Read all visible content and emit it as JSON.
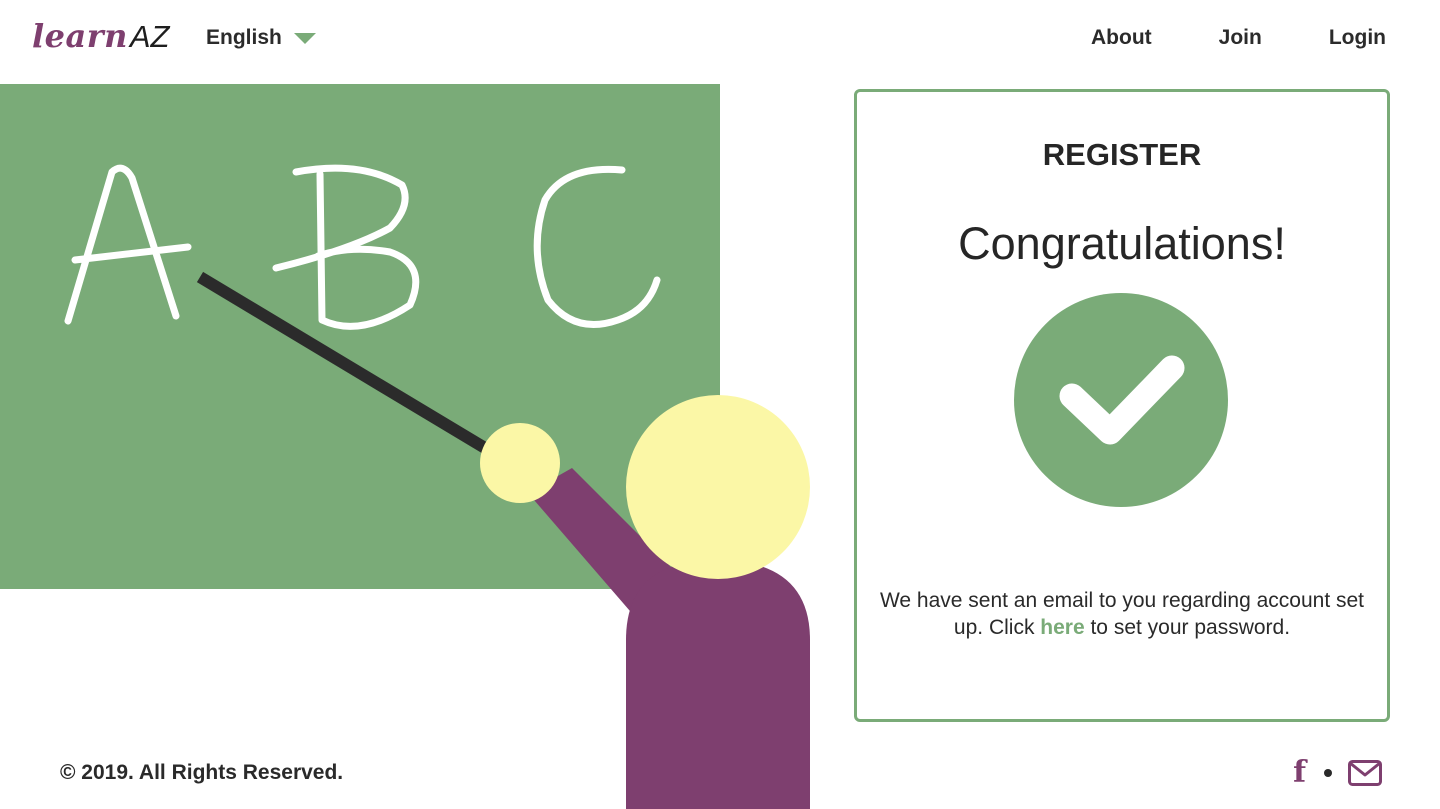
{
  "header": {
    "logo_learn": "learn",
    "logo_az": "AZ",
    "language": "English",
    "nav": {
      "about": "About",
      "join": "Join",
      "login": "Login"
    }
  },
  "illustration": {
    "letters": [
      "A",
      "B",
      "C"
    ]
  },
  "register": {
    "title": "REGISTER",
    "heading": "Congratulations!",
    "message_before": "We have sent an email to you regarding account set up. Click ",
    "link": "here",
    "message_after": " to set your password."
  },
  "footer": {
    "copyright": "© 2019. All Rights Reserved.",
    "facebook_glyph": "f",
    "icons": [
      "facebook-icon",
      "email-icon"
    ]
  },
  "colors": {
    "accent_green": "#7aab78",
    "brand_purple": "#7e3f6f",
    "skin_yellow": "#fbf7a6",
    "pointer": "#2b2b2b"
  }
}
